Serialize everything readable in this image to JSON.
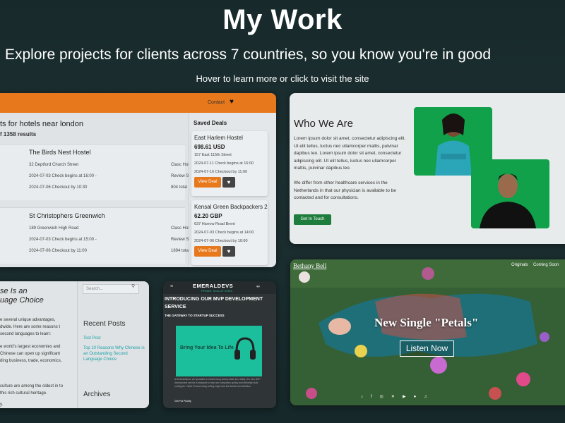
{
  "header": {
    "title": "My Work",
    "subtitle": "Explore projects for clients across 7 countries, so you know you're in good",
    "hint": "Hover to learn more or click to visit the site"
  },
  "hotels": {
    "contact": "Contact",
    "results_title": "ts for hotels near london",
    "results_count": "f 1358 results",
    "rows": [
      {
        "name": "The Birds Nest Hostel",
        "addr": "32 Deptford Church Street",
        "in": "2024-07-03 Check begins at 16:00 -",
        "out": "2024-07-06 Checkout by 10:30",
        "r1": "Clasc Hol",
        "r2": "Review S",
        "r3": "804 total"
      },
      {
        "name": "St Christophers Greenwich",
        "addr": "189 Greenwich High Road",
        "in": "2024-07-03 Check begins at 15:00 -",
        "out": "2024-07-06 Checkout by 11:00",
        "r1": "Clasc Hol",
        "r2": "Review S",
        "r3": "1894 tota"
      }
    ],
    "saved_title": "Saved Deals",
    "deals": [
      {
        "name": "East Harlem Hostel",
        "price": "698.61 USD",
        "l1": "157 East 115th Street",
        "l2": "2024-07-11 Check begins at 16:00",
        "l3": "2024-07-16 Checkout by 11:00",
        "btn": "View Deal"
      },
      {
        "name": "Kensal Green Backpackers 2",
        "price": "62.20 GBP",
        "l1": "637 Harrow Road Brent",
        "l2": "2024-07-03 Check begins at 14:00",
        "l3": "2024-07-06 Checkout by 10:00",
        "btn": "View Deal"
      }
    ]
  },
  "about": {
    "heading": "Who We Are",
    "p1": "Lorem ipsum dolor sit amet, consectetur adipiscing elit. Ut elit tellus, luctus nec ullamcorper mattis, pulvinar dapibus leo. Lorem ipsum dolor sit amet, consectetur adipiscing elit. Ut elit tellus, luctus nec ullamcorper mattis, pulvinar dapibus leo.",
    "p2": "We differ from other healthcare services in the Netherlands in that our physician is available to be contacted and for consultations.",
    "button": "Get In Touch"
  },
  "blog": {
    "title_line1": "se Is an",
    "title_line2": "uage Choice",
    "para1": "e several unique advantages, dwide. Here are some reasons t second languages to learn:",
    "para2": "e world's largest economies and Chinese can open up significant ding business, trade, economics,",
    "para3": "culture are among the oldest in to this rich cultural heritage.",
    "para4": "y.",
    "search_placeholder": "Search...",
    "recent_posts": "Recent Posts",
    "link1": "Test Post",
    "link2": "Top 10 Reasons Why Chinese is an Outstanding Second Language Choice",
    "archives": "Archives"
  },
  "emerald": {
    "logo": "EMERALDEVS",
    "logo_sub": "PRIME SOLUTIONS",
    "heading": "INTRODUCING OUR MVP DEVELOPMENT SERVICE",
    "sub": "THE GATEWAY TO STARTUP SUCCESS",
    "hero_text": "Bring Your Idea To Life",
    "para": "At EmeraldDevs, we specialize in transforming startup ideas into reality. Our new MVP development service is designed to help new companies quickly and efficiently build prototypes. Viable Product using cutting-edge tools like Bubble and Webflow.",
    "cta": "Get Put Priority"
  },
  "music": {
    "brand": "Bethany Bell",
    "nav1": "Originals",
    "nav2": "Coming Soon",
    "song": "New Single \"Petals\"",
    "button": "Listen Now"
  },
  "colors": {
    "orange": "#e8781c",
    "green": "#11a14a",
    "teal": "#1bbf9c"
  }
}
